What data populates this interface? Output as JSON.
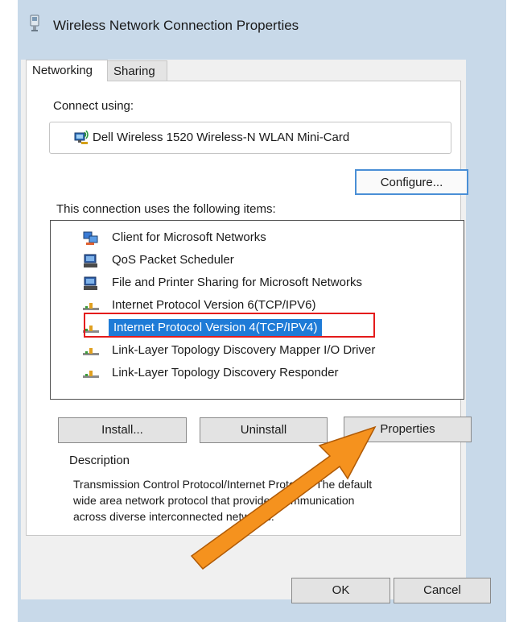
{
  "window": {
    "title": "Wireless Network Connection Properties",
    "title_icon": "network-adapter-icon"
  },
  "tabs": [
    {
      "label": "Networking",
      "active": true
    },
    {
      "label": "Sharing",
      "active": false
    }
  ],
  "connect_using": {
    "label": "Connect using:",
    "adapter_name": "Dell Wireless 1520 Wireless-N WLAN Mini-Card",
    "adapter_icon": "wireless-adapter-icon"
  },
  "configure_label": "Configure...",
  "items_heading": "This connection uses the following items:",
  "items": [
    {
      "label": "Client for Microsoft Networks",
      "icon": "network-client-icon",
      "selected": false
    },
    {
      "label": "QoS Packet Scheduler",
      "icon": "service-icon",
      "selected": false
    },
    {
      "label": "File and Printer Sharing for Microsoft Networks",
      "icon": "service-icon",
      "selected": false
    },
    {
      "label": "Internet  Protocol Version 6(TCP/IPV6)",
      "icon": "protocol-icon",
      "selected": false
    },
    {
      "label": "Internet Protocol Version 4(TCP/IPV4)",
      "icon": "protocol-icon",
      "selected": true
    },
    {
      "label": "Link-Layer Topology Discovery Mapper I/O Driver",
      "icon": "protocol-icon",
      "selected": false
    },
    {
      "label": "Link-Layer Topology Discovery Responder",
      "icon": "protocol-icon",
      "selected": false
    }
  ],
  "buttons": {
    "install": "Install...",
    "uninstall": "Uninstall",
    "properties": "Properties",
    "ok": "OK",
    "cancel": "Cancel"
  },
  "description": {
    "heading": "Description",
    "line1": "Transmission Control Protocol/Internet Protocol. The default",
    "line2": "wide area network protocol that provides communication",
    "line3": "across diverse interconnected networks."
  },
  "annotation": {
    "highlight_color": "#e41b1b",
    "arrow_color": "#f5921e"
  },
  "colors": {
    "selection": "#1e7bd7",
    "window_background": "#c8d9e9",
    "focus_border": "#4a8fd6"
  }
}
